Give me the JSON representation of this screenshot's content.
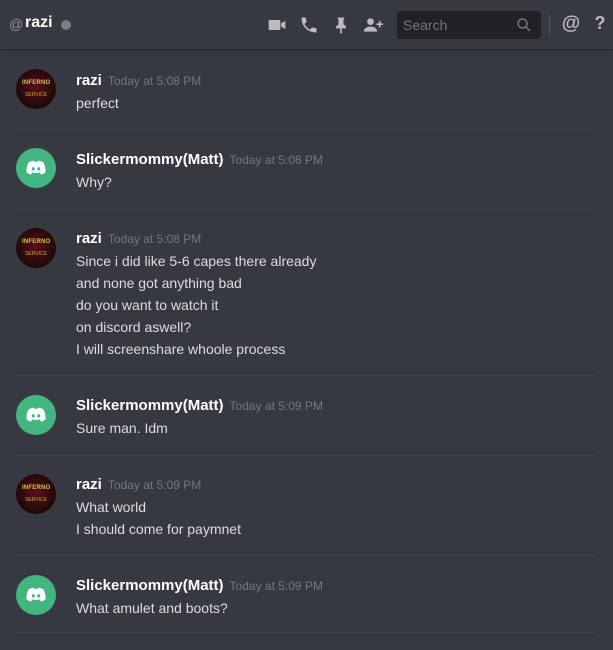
{
  "channel": {
    "prefix": "@",
    "name": "razi"
  },
  "search": {
    "placeholder": "Search"
  },
  "header_icons": [
    "video-icon",
    "phone-icon",
    "pin-icon",
    "add-friend-icon"
  ],
  "mentions_label": "@",
  "help_label": "?",
  "colors": {
    "background": "#36393f",
    "discord_avatar": "#43b581",
    "timestamp": "#72767d",
    "text": "#dcddde"
  },
  "messages": [
    {
      "author": "razi",
      "timestamp": "Today at 5:08 PM",
      "lines": [
        "perfect"
      ]
    },
    {
      "author": "Slickermommy(Matt)",
      "timestamp": "Today at 5:08 PM",
      "lines": [
        "Why?"
      ]
    },
    {
      "author": "razi",
      "timestamp": "Today at 5:08 PM",
      "lines": [
        "Since i did like 5-6 capes there already",
        "and none got anything bad",
        "do you want to watch it",
        "on discord aswell?",
        "I will screenshare whoole process"
      ]
    },
    {
      "author": "Slickermommy(Matt)",
      "timestamp": "Today at 5:09 PM",
      "lines": [
        "Sure man. Idm"
      ]
    },
    {
      "author": "razi",
      "timestamp": "Today at 5:09 PM",
      "lines": [
        "What world",
        "I should come for paymnet"
      ]
    },
    {
      "author": "Slickermommy(Matt)",
      "timestamp": "Today at 5:09 PM",
      "lines": [
        "What amulet and boots?"
      ]
    }
  ]
}
